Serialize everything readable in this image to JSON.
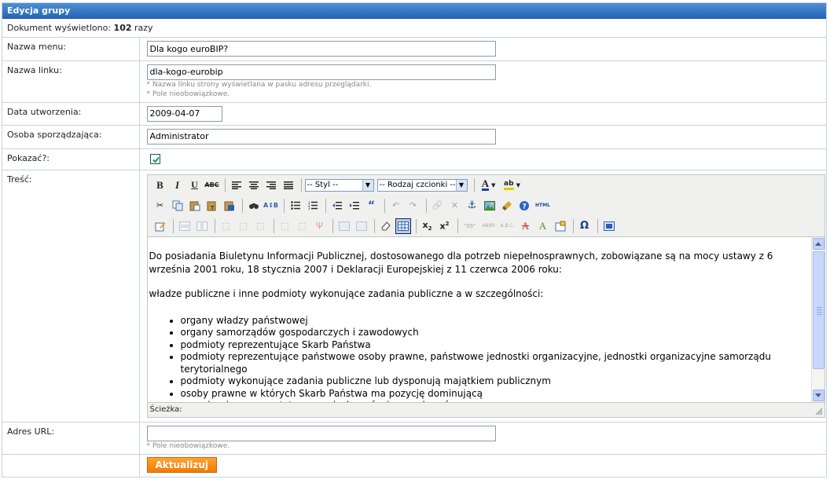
{
  "panel": {
    "title": "Edycja grupy"
  },
  "views": {
    "prefix": "Dokument wyświetlono:",
    "count": "102",
    "suffix": "razy"
  },
  "fields": {
    "menu_name": {
      "label": "Nazwa menu:",
      "value": "Dla kogo euroBIP?"
    },
    "link_name": {
      "label": "Nazwa linku:",
      "value": "dla-kogo-eurobip",
      "hint1": "* Nazwa linku strony wyświetlana w pasku adresu przeglądarki.",
      "hint2": "* Pole nieobowiązkowe."
    },
    "created": {
      "label": "Data utworzenia:",
      "value": "2009-04-07"
    },
    "author": {
      "label": "Osoba sporządzająca:",
      "value": "Administrator"
    },
    "show": {
      "label": "Pokazać?:",
      "checked": true
    },
    "content": {
      "label": "Treść:"
    },
    "url": {
      "label": "Adres URL:",
      "value": "",
      "hint": "* Pole nieobowiązkowe."
    }
  },
  "editor": {
    "style_select": "-- Styl --",
    "font_select": "-- Rodzaj czcionki --",
    "path_label": "Ścieżka:",
    "paragraph1": "Do posiadania Biuletynu Informacji Publicznej, dostosowanego dla potrzeb niepełnosprawnych, zobowiązane są na mocy ustawy z 6 września 2001 roku, 18 stycznia 2007 i Deklaracji Europejskiej z 11 czerwca 2006 roku:",
    "paragraph2": "władze publiczne i inne podmioty wykonujące zadania publiczne a w szczególności:",
    "list": [
      "organy władzy państwowej",
      "organy samorządów gospodarczych i zawodowych",
      "podmioty reprezentujące Skarb Państwa",
      "podmioty reprezentujące państwowe osoby prawne, państwowe jednostki organizacyjne, jednostki organizacyjne samorządu terytorialnego",
      "podmioty wykonujące zadania publiczne lub dysponują majątkiem publicznym",
      "osoby prawne w których Skarb Państwa ma pozycję dominującą",
      "organizacje reprezentatywne związkowców i pracodawców"
    ]
  },
  "actions": {
    "submit": "Aktualizuj"
  },
  "colors": {
    "header": "#2466b4",
    "submit": "#f37b00",
    "border": "#c5d3e2"
  }
}
